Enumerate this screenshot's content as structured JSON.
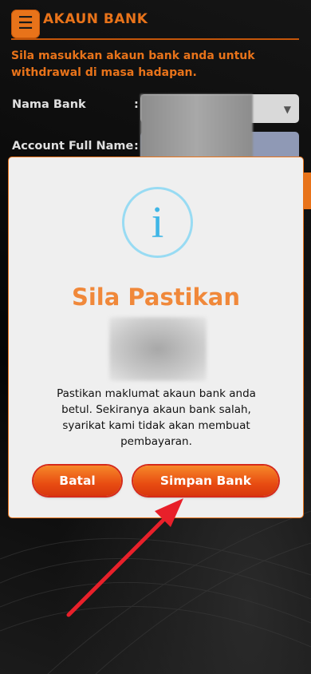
{
  "header": {
    "menu_icon": "hamburger-icon",
    "title": "AKAUN BANK"
  },
  "form": {
    "intro": "Sila masukkan akaun bank anda untuk withdrawal di masa hadapan.",
    "bank_name_label": "Nama Bank",
    "full_name_label": "Account Full Name",
    "colon": ":"
  },
  "dialog": {
    "icon": "info-icon",
    "icon_glyph": "i",
    "title": "Sila Pastikan",
    "message": "Pastikan maklumat akaun bank anda betul. Sekiranya akaun bank salah, syarikat kami tidak akan membuat pembayaran.",
    "cancel_label": "Batal",
    "save_label": "Simpan Bank"
  },
  "colors": {
    "accent": "#e8731a",
    "dialog_title": "#f0883a",
    "info_icon": "#3fb6e6",
    "button_gradient_top": "#f68828",
    "button_gradient_bottom": "#d8360c",
    "annotation_arrow": "#e8202a"
  }
}
